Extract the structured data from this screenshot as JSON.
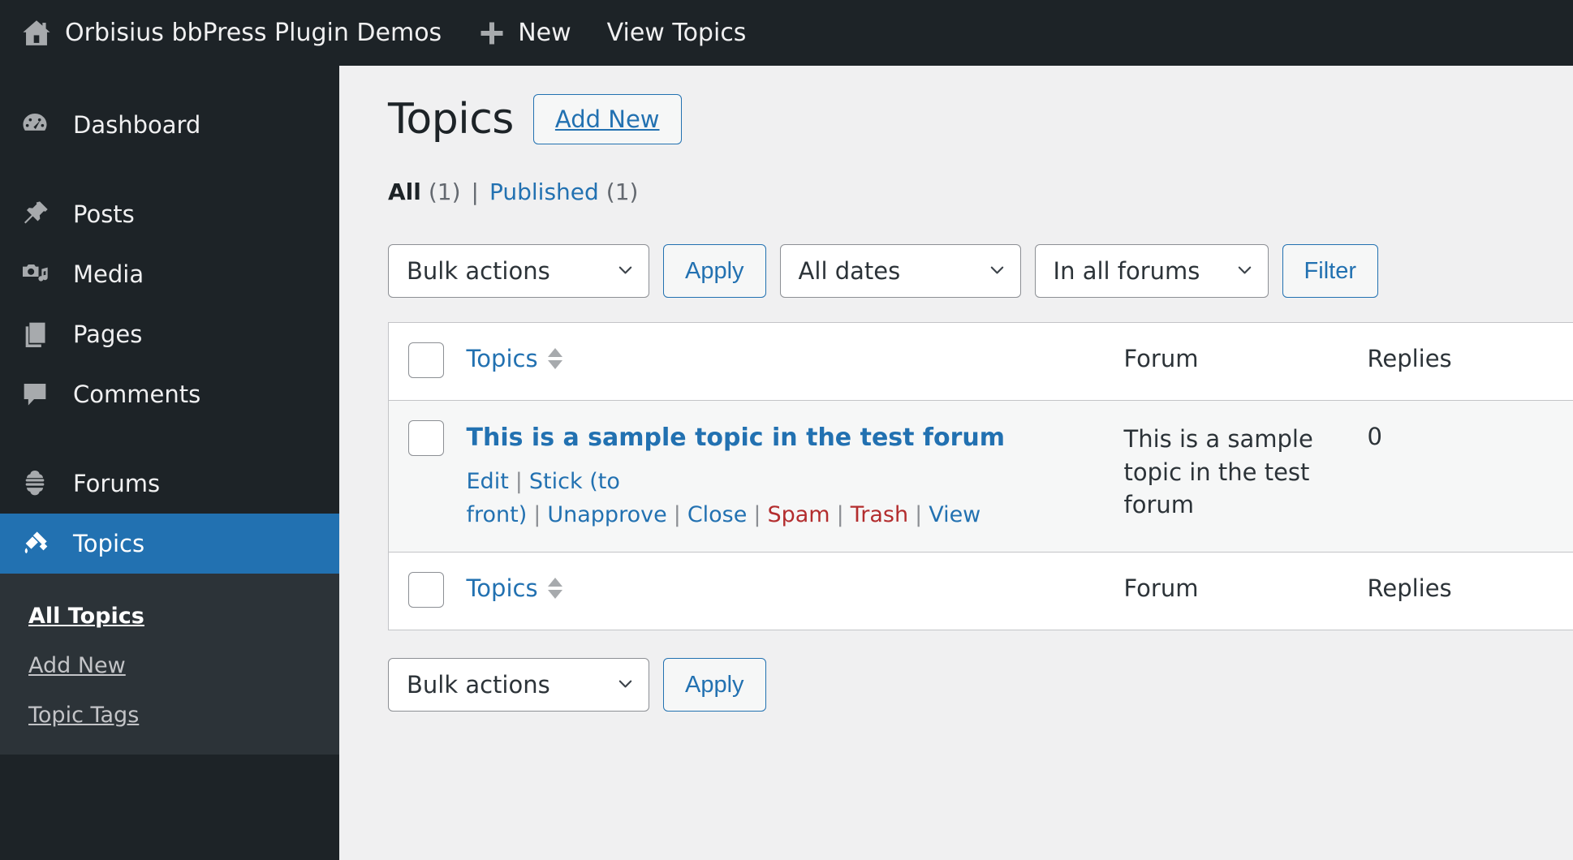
{
  "adminbar": {
    "home_icon": "home-icon",
    "site_title": "Orbisius bbPress Plugin Demos",
    "new_icon": "plus-icon",
    "new_label": "New",
    "view_topics_label": "View Topics"
  },
  "sidebar": {
    "items": [
      {
        "label": "Dashboard",
        "icon": "dashboard-icon",
        "current": false
      },
      {
        "label": "Posts",
        "icon": "pin-icon",
        "current": false
      },
      {
        "label": "Media",
        "icon": "media-icon",
        "current": false
      },
      {
        "label": "Pages",
        "icon": "pages-icon",
        "current": false
      },
      {
        "label": "Comments",
        "icon": "comments-icon",
        "current": false
      },
      {
        "label": "Forums",
        "icon": "forums-icon",
        "current": false
      },
      {
        "label": "Topics",
        "icon": "topics-icon",
        "current": true
      }
    ],
    "submenu": [
      {
        "label": "All Topics",
        "current": true
      },
      {
        "label": "Add New",
        "current": false
      },
      {
        "label": "Topic Tags",
        "current": false
      }
    ],
    "accent_color": "#2271b1",
    "background_color": "#1d2327",
    "submenu_background": "#2c3338"
  },
  "page": {
    "title": "Topics",
    "add_new_label": "Add New"
  },
  "status_filters": {
    "all_label": "All",
    "all_count": "(1)",
    "separator": "|",
    "published_label": "Published",
    "published_count": "(1)"
  },
  "tablenav_top": {
    "bulk_actions_value": "Bulk actions",
    "apply_label": "Apply",
    "dates_value": "All dates",
    "forums_value": "In all forums",
    "filter_label": "Filter"
  },
  "tablenav_bottom": {
    "bulk_actions_value": "Bulk actions",
    "apply_label": "Apply"
  },
  "table": {
    "columns": {
      "topics": "Topics",
      "forum": "Forum",
      "replies": "Replies"
    },
    "rows": [
      {
        "title": "This is a sample topic in the test forum",
        "forum": "This is a sample topic in the test forum",
        "replies": "0",
        "actions": [
          {
            "label": "Edit",
            "style": "blue"
          },
          {
            "label": "Stick (to front)",
            "style": "blue"
          },
          {
            "label": "Unapprove",
            "style": "blue"
          },
          {
            "label": "Close",
            "style": "blue"
          },
          {
            "label": "Spam",
            "style": "red"
          },
          {
            "label": "Trash",
            "style": "red"
          },
          {
            "label": "View",
            "style": "blue"
          }
        ]
      }
    ]
  },
  "colors": {
    "link": "#2271b1",
    "danger": "#b32d2e",
    "page_bg": "#f0f0f1",
    "row_bg": "#f6f7f7"
  }
}
